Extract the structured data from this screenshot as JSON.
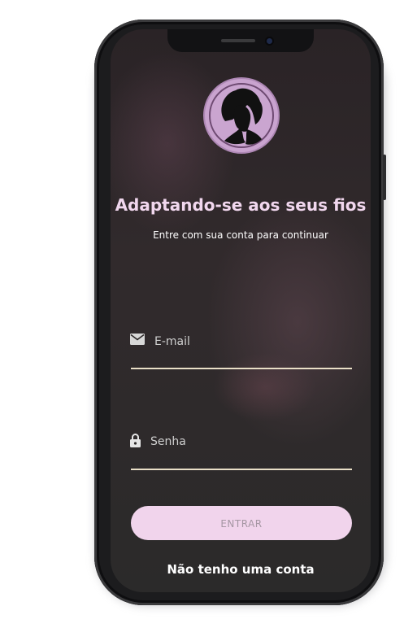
{
  "login": {
    "title": "Adaptando-se aos seus fios",
    "subtitle": "Entre com sua conta para continuar",
    "email_placeholder": "E-mail",
    "password_placeholder": "Senha",
    "submit_label": "ENTRAR",
    "signup_link": "Não tenho uma conta"
  },
  "colors": {
    "accent": "#f1d4ec",
    "logo": "#c9a3cf",
    "title": "#f1d7ee",
    "underline": "#e9dfc7"
  },
  "icons": {
    "email": "envelope-icon",
    "password": "lock-icon",
    "logo": "woman-silhouette-icon"
  }
}
